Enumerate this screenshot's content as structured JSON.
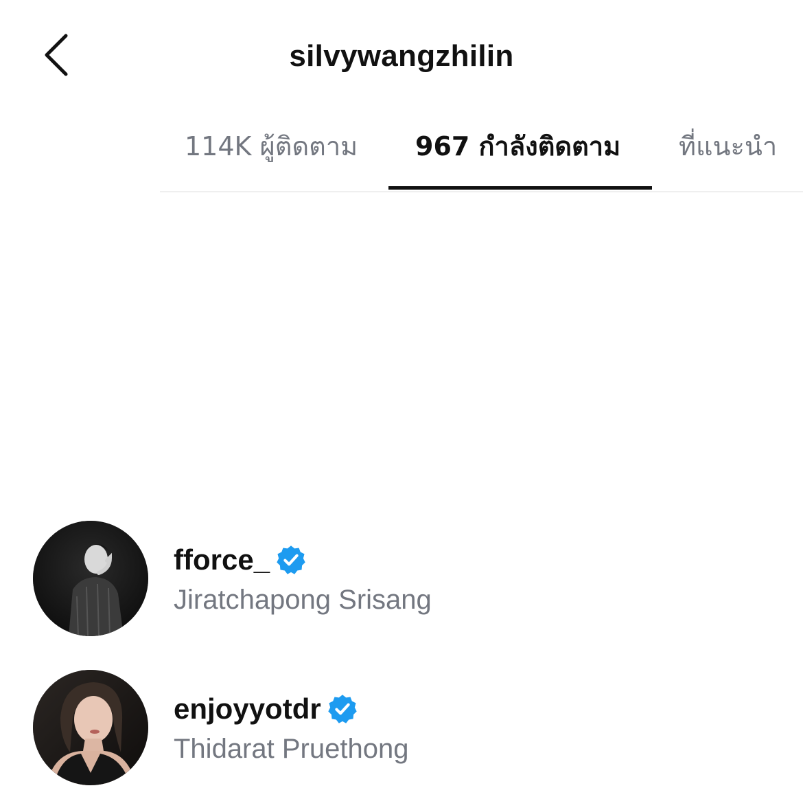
{
  "header": {
    "title": "silvywangzhilin",
    "back_icon": "chevron-left-icon"
  },
  "tabs": [
    {
      "label": "114K ผู้ติดตาม",
      "active": false
    },
    {
      "label": "967 กำลังติดตาม",
      "active": true
    },
    {
      "label": "ที่แนะนำ",
      "active": false
    }
  ],
  "accounts": [
    {
      "username": "fforce_",
      "full_name": "Jiratchapong Srisang",
      "verified": true
    },
    {
      "username": "enjoyyotdr",
      "full_name": "Thidarat Pruethong",
      "verified": true
    }
  ],
  "colors": {
    "primary_text": "#111111",
    "secondary_text": "#737780",
    "verified_badge": "#1d9bf0",
    "divider": "#efefef"
  }
}
